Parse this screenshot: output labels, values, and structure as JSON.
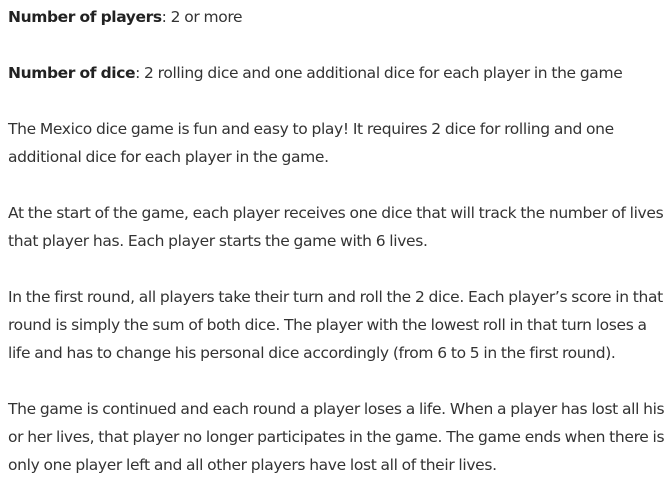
{
  "players": {
    "label": "Number of players",
    "value": ": 2 or more"
  },
  "dice": {
    "label": "Number of dice",
    "value": ": 2 rolling dice and one additional dice for each player in the game"
  },
  "paragraphs": {
    "intro": "The Mexico dice game is fun and easy to play! It requires 2 dice for rolling and one additional dice for each player in the game.",
    "start": "At the start of the game, each player receives one dice that will track the number of lives that player has. Each player starts the game with 6 lives.",
    "round": "In the first round, all players take their turn and roll the 2 dice. Each player’s score in that round is simply the sum of both dice. The player with the lowest roll in that turn loses a life and has to change his personal dice accordingly (from 6 to 5 in the first round).",
    "continue": "The game is continued and each round a player loses a life. When a player has lost all his or her lives, that player no longer participates in the game. The game ends when there is only one player left and all other players have lost all of their lives."
  }
}
